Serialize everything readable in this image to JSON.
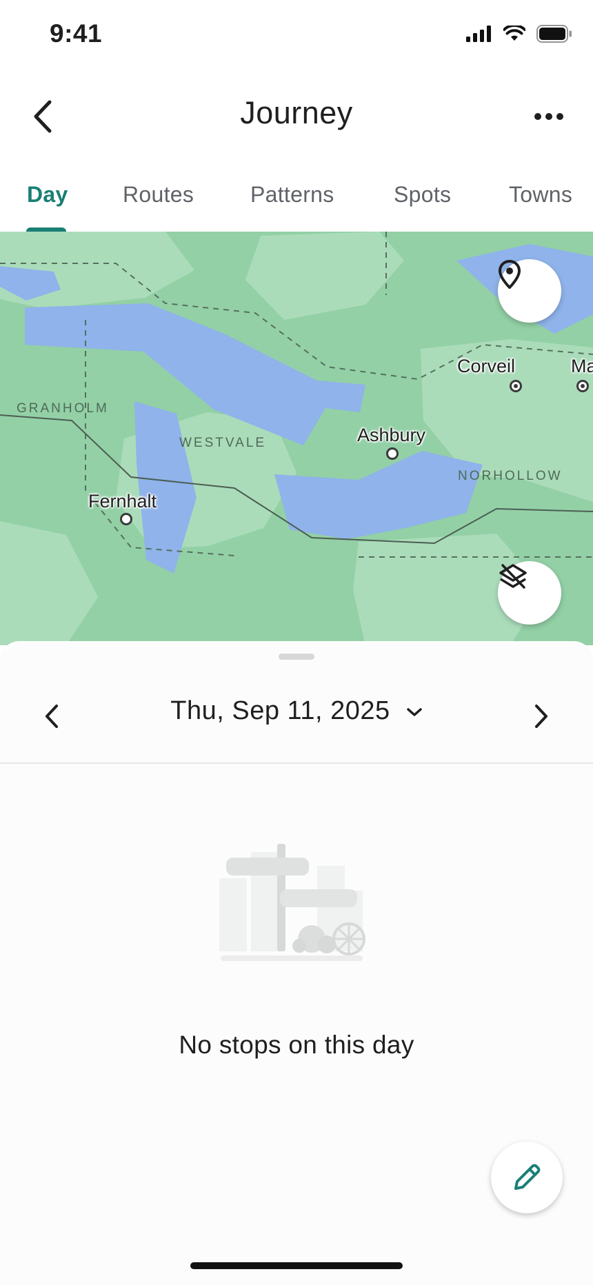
{
  "status_bar": {
    "time": "9:41"
  },
  "header": {
    "title": "Journey"
  },
  "tabs": [
    {
      "label": "Day",
      "active": true
    },
    {
      "label": "Routes",
      "active": false
    },
    {
      "label": "Patterns",
      "active": false
    },
    {
      "label": "Spots",
      "active": false
    },
    {
      "label": "Towns",
      "active": false
    }
  ],
  "map": {
    "places": {
      "corveil": "Corveil",
      "ma": "Ma",
      "ashbury": "Ashbury",
      "fernhalt": "Fernhalt"
    },
    "regions": {
      "granholm": "GRANHOLM",
      "westvale": "WESTVALE",
      "norhollow": "NORHOLLOW"
    }
  },
  "sheet": {
    "date": "Thu, Sep 11, 2025",
    "empty_message": "No stops on this day"
  },
  "colors": {
    "accent": "#1a7f74",
    "map_land": "#93d0a6",
    "map_land_light": "#abdcba",
    "map_water": "#8fb3ea"
  },
  "icons": {
    "back": "chevron-left-icon",
    "more": "more-horizontal-icon",
    "location": "location-pin-icon",
    "layers": "layers-off-icon",
    "prev": "chevron-left-icon",
    "next": "chevron-right-icon",
    "dropdown": "chevron-down-icon",
    "edit": "pencil-icon"
  }
}
